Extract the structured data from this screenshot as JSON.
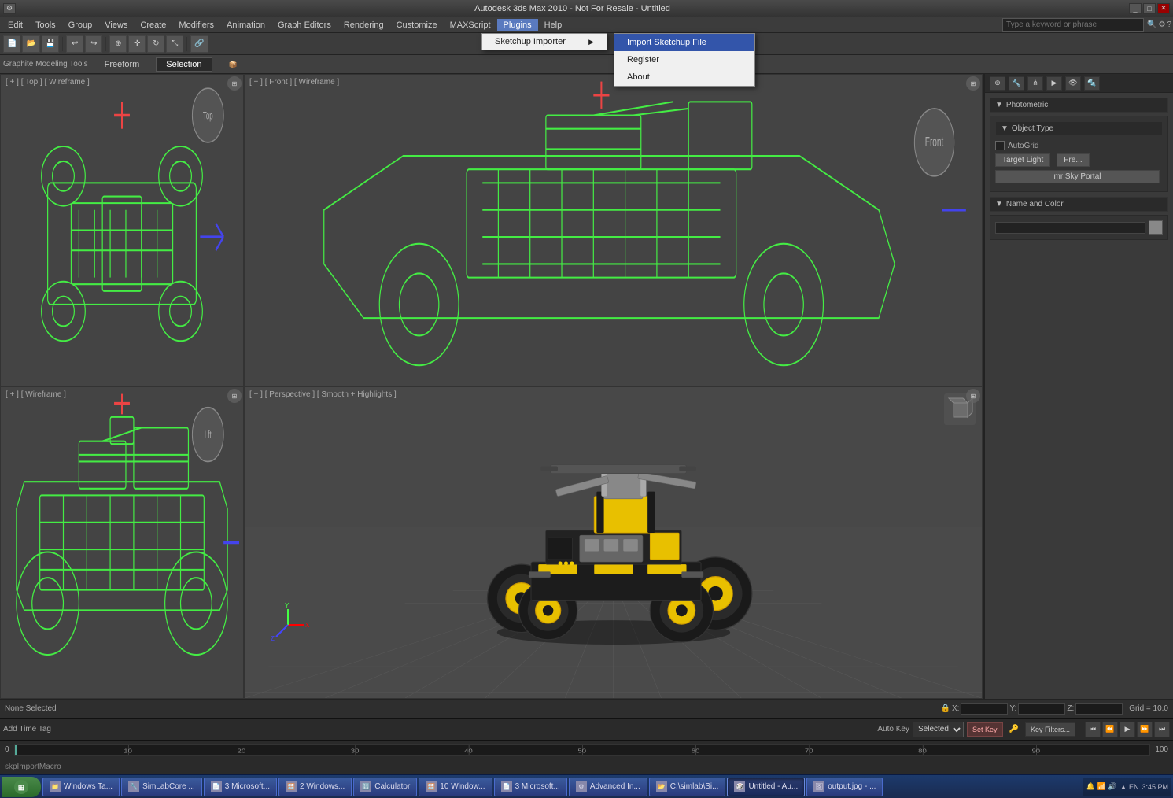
{
  "titlebar": {
    "title": "Autodesk 3ds Max 2010 - Not For Resale - Untitled"
  },
  "menubar": {
    "items": [
      {
        "label": "Edit",
        "id": "edit"
      },
      {
        "label": "Tools",
        "id": "tools"
      },
      {
        "label": "Group",
        "id": "group"
      },
      {
        "label": "Views",
        "id": "views"
      },
      {
        "label": "Create",
        "id": "create"
      },
      {
        "label": "Modifiers",
        "id": "modifiers"
      },
      {
        "label": "Animation",
        "id": "animation"
      },
      {
        "label": "Graph Editors",
        "id": "graph-editors"
      },
      {
        "label": "Rendering",
        "id": "rendering"
      },
      {
        "label": "Customize",
        "id": "customize"
      },
      {
        "label": "MAXScript",
        "id": "maxscript"
      },
      {
        "label": "Plugins",
        "id": "plugins",
        "active": true
      },
      {
        "label": "Help",
        "id": "help"
      }
    ]
  },
  "plugins_dropdown": {
    "items": [
      {
        "label": "Sketchup Importer",
        "id": "sketchup-importer",
        "has_sub": true
      }
    ]
  },
  "sketchup_submenu": {
    "items": [
      {
        "label": "Import Sketchup File",
        "id": "import-sketchup",
        "highlighted": true
      },
      {
        "label": "Register",
        "id": "register"
      },
      {
        "label": "About",
        "id": "about"
      }
    ]
  },
  "modeling_toolbar": {
    "title": "Graphite Modeling Tools",
    "tabs": [
      {
        "label": "Freeform",
        "id": "freeform"
      },
      {
        "label": "Selection",
        "id": "selection"
      },
      {
        "label": "...",
        "id": "more"
      }
    ]
  },
  "viewports": {
    "top_left": {
      "label": "[ + ] [ Top ] [ Wireframe ]"
    },
    "top_right": {
      "label": "[ + ] [ Front ] [ Wireframe ]"
    },
    "bottom_left": {
      "label": "[ + ] [ Wireframe ]"
    },
    "bottom_right": {
      "label": "[ + ] [ Perspective ] [ Smooth + Highlights ]"
    }
  },
  "right_panel": {
    "section_photometric": "Photometric",
    "object_type_label": "Object Type",
    "autogrid_label": "AutoGrid",
    "btn_target_light": "Target Light",
    "btn_free": "Fre...",
    "mr_sky_portal": "mr Sky Portal",
    "section_name_color": "Name and Color"
  },
  "search_bar": {
    "placeholder": "Type a keyword or phrase"
  },
  "status_bar": {
    "selection": "None Selected",
    "macro": "skpImportMacro",
    "x_label": "X:",
    "y_label": "Y:",
    "z_label": "Z:",
    "grid_label": "Grid = 10.0",
    "auto_key": "Auto Key",
    "selected_label": "Selected",
    "set_key": "Set Key",
    "key_filters": "Key Filters..."
  },
  "timeline": {
    "start": "0",
    "end": "100",
    "current": "0"
  },
  "taskbar": {
    "items": [
      {
        "label": "Windows Ta...",
        "id": "windows-ta"
      },
      {
        "label": "SimLabCore ...",
        "id": "simlab"
      },
      {
        "label": "3 Microsoft...",
        "id": "microsoft1"
      },
      {
        "label": "2 Windows...",
        "id": "windows2"
      },
      {
        "label": "Calculator",
        "id": "calculator"
      },
      {
        "label": "10 Window...",
        "id": "window10"
      },
      {
        "label": "3 Microsoft...",
        "id": "microsoft3"
      },
      {
        "label": "Advanced In...",
        "id": "advanced"
      },
      {
        "label": "C:\\simlab\\Si...",
        "id": "simlab-path"
      },
      {
        "label": "Untitled - Au...",
        "id": "untitled-au",
        "active": true
      },
      {
        "label": "output.jpg - ...",
        "id": "output-jpg"
      }
    ],
    "tray_time": "▲ EN"
  }
}
